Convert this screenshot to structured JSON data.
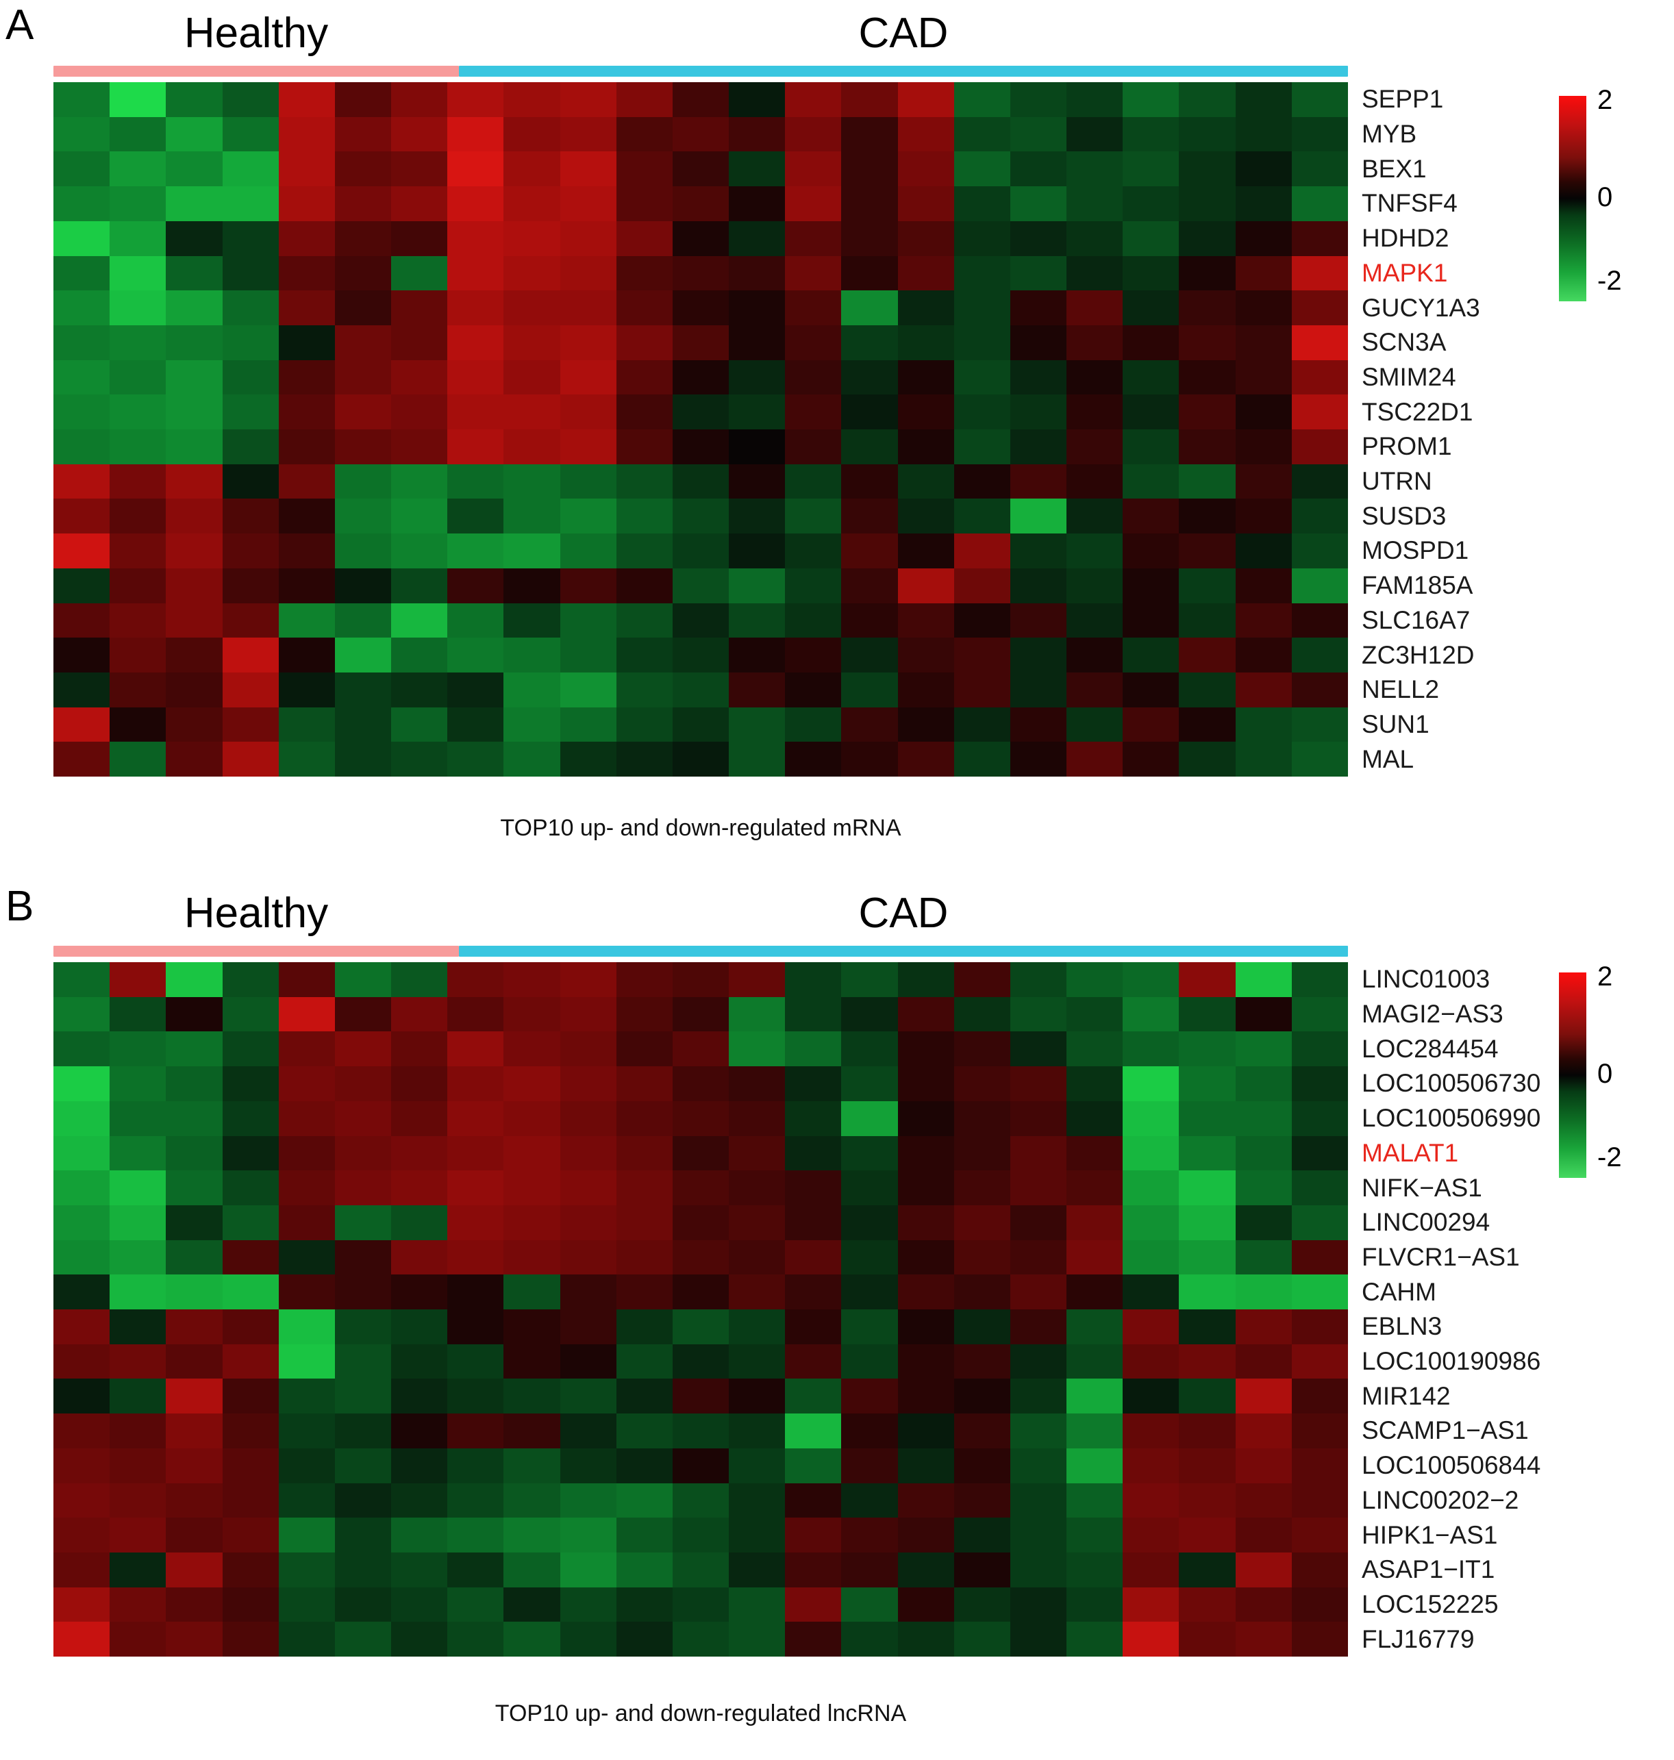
{
  "figure": {
    "colors": {
      "healthy_bar": "#f79b9b",
      "cad_bar": "#39c6e0",
      "highlight_label": "#e8261c",
      "heat_high": "#ff0000",
      "heat_mid": "#000000",
      "heat_low": "#00cc44"
    }
  },
  "panels": [
    {
      "letter": "A",
      "groups": {
        "healthy": "Healthy",
        "cad": "CAD"
      },
      "caption": "TOP10 up- and down-regulated mRNA",
      "legend": {
        "ticks": [
          "2",
          "0",
          "-2"
        ]
      },
      "chart_data": {
        "type": "heatmap",
        "title": "TOP10 up- and down-regulated mRNA",
        "xlabel": "",
        "ylabel": "",
        "zlim": [
          -2.5,
          2.5
        ],
        "colorbar_ticks": [
          2,
          0,
          -2
        ],
        "colormap": "green-black-red",
        "column_groups": [
          {
            "name": "Healthy",
            "columns": 4,
            "color": "#f79b9b"
          },
          {
            "name": "CAD",
            "columns": 19,
            "color": "#39c6e0"
          }
        ],
        "rows": [
          "SEPP1",
          "MYB",
          "BEX1",
          "TNFSF4",
          "HDHD2",
          "MAPK1",
          "GUCY1A3",
          "SCN3A",
          "SMIM24",
          "TSC22D1",
          "PROM1",
          "UTRN",
          "SUSD3",
          "MOSPD1",
          "FAM185A",
          "SLC16A7",
          "ZC3H12D",
          "NELL2",
          "SUN1",
          "MAL"
        ],
        "highlighted_rows": [
          "MAPK1"
        ],
        "values": [
          [
            -1.1,
            -2.4,
            -1.0,
            -0.7,
            1.6,
            0.6,
            1.0,
            1.5,
            1.3,
            1.4,
            1.0,
            0.4,
            -0.1,
            1.1,
            0.8,
            1.4,
            -0.8,
            -0.5,
            -0.4,
            -0.9,
            -0.6,
            -0.3,
            -0.7
          ],
          [
            -1.2,
            -1.0,
            -1.6,
            -1.0,
            1.5,
            0.9,
            1.2,
            1.9,
            1.1,
            1.2,
            0.5,
            0.6,
            0.4,
            0.9,
            0.3,
            1.0,
            -0.5,
            -0.6,
            -0.2,
            -0.5,
            -0.4,
            -0.3,
            -0.4
          ],
          [
            -1.0,
            -1.5,
            -1.3,
            -1.7,
            1.5,
            0.7,
            0.8,
            2.0,
            1.3,
            1.6,
            0.6,
            0.3,
            -0.3,
            1.1,
            0.3,
            0.9,
            -0.8,
            -0.4,
            -0.5,
            -0.6,
            -0.3,
            -0.1,
            -0.5
          ],
          [
            -1.2,
            -1.3,
            -1.8,
            -1.8,
            1.4,
            0.9,
            1.1,
            1.8,
            1.4,
            1.5,
            0.6,
            0.5,
            0.1,
            1.2,
            0.3,
            0.8,
            -0.4,
            -0.8,
            -0.5,
            -0.4,
            -0.3,
            -0.2,
            -0.9
          ],
          [
            -2.2,
            -1.6,
            -0.2,
            -0.4,
            0.9,
            0.5,
            0.4,
            1.6,
            1.5,
            1.4,
            0.9,
            0.1,
            -0.2,
            0.6,
            0.3,
            0.5,
            -0.3,
            -0.2,
            -0.3,
            -0.6,
            -0.2,
            0.1,
            0.4
          ],
          [
            -1.0,
            -2.1,
            -0.8,
            -0.4,
            0.6,
            0.4,
            -0.9,
            1.6,
            1.4,
            1.3,
            0.5,
            0.4,
            0.3,
            0.8,
            0.2,
            0.6,
            -0.4,
            -0.5,
            -0.2,
            -0.3,
            0.1,
            0.5,
            1.6
          ],
          [
            -1.3,
            -2.0,
            -1.6,
            -0.9,
            0.8,
            0.3,
            0.7,
            1.4,
            1.2,
            1.2,
            0.6,
            0.2,
            0.1,
            0.5,
            -1.3,
            -0.2,
            -0.4,
            0.2,
            0.6,
            -0.2,
            0.3,
            0.2,
            0.8
          ],
          [
            -1.1,
            -1.2,
            -1.1,
            -1.0,
            -0.1,
            0.8,
            0.7,
            1.6,
            1.3,
            1.4,
            0.9,
            0.5,
            0.1,
            0.4,
            -0.4,
            -0.3,
            -0.4,
            0.1,
            0.4,
            0.2,
            0.4,
            0.3,
            1.9
          ],
          [
            -1.3,
            -1.1,
            -1.4,
            -0.8,
            0.5,
            0.8,
            1.0,
            1.5,
            1.2,
            1.5,
            0.6,
            0.1,
            -0.2,
            0.3,
            -0.2,
            0.1,
            -0.5,
            -0.2,
            0.1,
            -0.3,
            0.2,
            0.3,
            1.0
          ],
          [
            -1.2,
            -1.3,
            -1.4,
            -0.9,
            0.6,
            1.0,
            0.9,
            1.4,
            1.4,
            1.3,
            0.4,
            -0.2,
            -0.3,
            0.4,
            -0.1,
            0.2,
            -0.4,
            -0.3,
            0.2,
            -0.2,
            0.4,
            0.1,
            1.5
          ],
          [
            -1.1,
            -1.2,
            -1.3,
            -0.6,
            0.5,
            0.7,
            0.8,
            1.5,
            1.3,
            1.4,
            0.5,
            0.1,
            0.0,
            0.3,
            -0.3,
            0.1,
            -0.5,
            -0.2,
            0.3,
            -0.4,
            0.3,
            0.2,
            0.9
          ],
          [
            1.5,
            0.9,
            1.3,
            -0.1,
            0.8,
            -1.0,
            -1.2,
            -0.9,
            -1.0,
            -0.8,
            -0.6,
            -0.3,
            0.1,
            -0.4,
            0.2,
            -0.3,
            0.1,
            0.4,
            0.2,
            -0.5,
            -0.7,
            0.3,
            -0.2
          ],
          [
            1.0,
            0.6,
            1.1,
            0.5,
            0.2,
            -1.1,
            -1.3,
            -0.5,
            -1.0,
            -1.2,
            -0.8,
            -0.5,
            -0.2,
            -0.6,
            0.3,
            -0.2,
            -0.4,
            -1.8,
            -0.2,
            0.3,
            0.1,
            0.2,
            -0.4
          ],
          [
            1.9,
            0.8,
            1.2,
            0.6,
            0.4,
            -1.0,
            -1.2,
            -1.4,
            -1.5,
            -1.0,
            -0.6,
            -0.4,
            -0.1,
            -0.3,
            0.5,
            0.1,
            1.1,
            -0.3,
            -0.4,
            0.2,
            0.3,
            -0.1,
            -0.5
          ],
          [
            -0.3,
            0.6,
            1.0,
            0.4,
            0.2,
            -0.1,
            -0.5,
            0.3,
            0.1,
            0.4,
            0.2,
            -0.6,
            -0.9,
            -0.4,
            0.3,
            1.4,
            0.8,
            -0.2,
            -0.3,
            0.1,
            -0.4,
            0.2,
            -1.2
          ],
          [
            0.6,
            0.8,
            1.0,
            0.7,
            -1.2,
            -0.9,
            -1.9,
            -1.0,
            -0.4,
            -0.8,
            -0.6,
            -0.2,
            -0.5,
            -0.3,
            0.2,
            0.4,
            0.1,
            0.3,
            -0.2,
            0.1,
            -0.3,
            0.4,
            0.2
          ],
          [
            0.1,
            0.7,
            0.5,
            1.7,
            0.1,
            -1.7,
            -0.9,
            -1.1,
            -1.0,
            -0.8,
            -0.4,
            -0.3,
            0.1,
            0.2,
            -0.2,
            0.3,
            0.4,
            -0.2,
            0.1,
            -0.3,
            0.5,
            0.2,
            -0.4
          ],
          [
            -0.2,
            0.5,
            0.4,
            1.4,
            -0.1,
            -0.4,
            -0.3,
            -0.2,
            -1.2,
            -1.4,
            -0.6,
            -0.5,
            0.3,
            0.1,
            -0.4,
            0.2,
            0.4,
            -0.2,
            0.3,
            0.1,
            -0.3,
            0.6,
            0.3
          ],
          [
            1.6,
            0.1,
            0.5,
            0.8,
            -0.6,
            -0.4,
            -0.8,
            -0.3,
            -1.1,
            -0.9,
            -0.5,
            -0.3,
            -0.6,
            -0.4,
            0.3,
            0.1,
            -0.2,
            0.2,
            -0.3,
            0.4,
            0.1,
            -0.5,
            -0.6
          ],
          [
            0.7,
            -0.8,
            0.6,
            1.4,
            -0.7,
            -0.4,
            -0.5,
            -0.6,
            -0.9,
            -0.3,
            -0.2,
            -0.1,
            -0.6,
            0.1,
            0.2,
            0.4,
            -0.4,
            0.1,
            0.6,
            0.2,
            -0.3,
            -0.5,
            -0.7
          ]
        ]
      }
    },
    {
      "letter": "B",
      "groups": {
        "healthy": "Healthy",
        "cad": "CAD"
      },
      "caption": "TOP10 up- and down-regulated lncRNA",
      "legend": {
        "ticks": [
          "2",
          "0",
          "-2"
        ]
      },
      "chart_data": {
        "type": "heatmap",
        "title": "TOP10 up- and down-regulated lncRNA",
        "xlabel": "",
        "ylabel": "",
        "zlim": [
          -2.5,
          2.5
        ],
        "colorbar_ticks": [
          2,
          0,
          -2
        ],
        "colormap": "green-black-red",
        "column_groups": [
          {
            "name": "Healthy",
            "columns": 4,
            "color": "#f79b9b"
          },
          {
            "name": "CAD",
            "columns": 19,
            "color": "#39c6e0"
          }
        ],
        "rows": [
          "LINC01003",
          "MAGI2-AS3",
          "LOC284454",
          "LOC100506730",
          "LOC100506990",
          "MALAT1",
          "NIFK-AS1",
          "LINC00294",
          "FLVCR1-AS1",
          "CAHM",
          "EBLN3",
          "LOC100190986",
          "MIR142",
          "SCAMP1-AS1",
          "LOC100506844",
          "LINC00202-2",
          "HIPK1-AS1",
          "ASAP1-IT1",
          "LOC152225",
          "FLJ16779"
        ],
        "highlighted_rows": [
          "MALAT1"
        ],
        "values": [
          [
            -0.9,
            1.1,
            -2.1,
            -0.6,
            0.6,
            -1.0,
            -0.7,
            0.8,
            0.9,
            1.0,
            0.6,
            0.5,
            0.7,
            -0.4,
            -0.6,
            -0.3,
            0.4,
            -0.5,
            -0.8
          ],
          [
            -1.1,
            -0.5,
            0.1,
            -0.7,
            1.8,
            0.4,
            0.9,
            0.6,
            0.8,
            0.9,
            0.5,
            0.3,
            -1.1,
            -0.4,
            -0.2,
            0.4,
            -0.3,
            -0.6,
            -0.5
          ],
          [
            -0.8,
            -0.9,
            -1.0,
            -0.5,
            0.8,
            1.0,
            0.7,
            1.2,
            0.9,
            0.8,
            0.4,
            0.6,
            -1.2,
            -0.9,
            -0.4,
            0.2,
            0.3,
            -0.2,
            -0.6
          ],
          [
            -2.2,
            -1.0,
            -0.8,
            -0.3,
            0.9,
            0.8,
            0.6,
            1.0,
            1.1,
            0.9,
            0.7,
            0.4,
            0.3,
            -0.2,
            -0.5,
            0.2,
            0.4,
            0.5,
            -0.3
          ],
          [
            -2.0,
            -0.9,
            -0.9,
            -0.4,
            0.8,
            0.9,
            0.7,
            1.1,
            1.0,
            0.8,
            0.6,
            0.5,
            0.4,
            -0.3,
            -1.6,
            0.1,
            0.3,
            0.4,
            -0.2
          ],
          [
            -1.9,
            -1.1,
            -0.8,
            -0.2,
            0.6,
            0.8,
            0.9,
            1.0,
            1.1,
            0.9,
            0.7,
            0.3,
            0.5,
            -0.2,
            -0.4,
            0.2,
            0.3,
            0.6,
            0.4
          ],
          [
            -1.6,
            -2.0,
            -0.9,
            -0.5,
            0.7,
            0.9,
            1.0,
            1.2,
            1.1,
            1.0,
            0.8,
            0.5,
            0.4,
            0.3,
            -0.3,
            0.2,
            0.4,
            0.6,
            0.5
          ],
          [
            -1.4,
            -1.8,
            -0.3,
            -0.7,
            0.6,
            -0.8,
            -0.6,
            1.1,
            1.0,
            0.9,
            0.8,
            0.4,
            0.5,
            0.3,
            -0.2,
            0.4,
            0.6,
            0.3,
            0.8
          ],
          [
            -1.3,
            -1.5,
            -0.7,
            0.5,
            -0.2,
            0.3,
            0.9,
            1.0,
            0.9,
            0.8,
            0.7,
            0.5,
            0.4,
            0.6,
            -0.3,
            0.2,
            0.5,
            0.4,
            0.9
          ],
          [
            -0.2,
            -1.9,
            -1.8,
            -1.9,
            0.4,
            0.3,
            0.2,
            0.1,
            -0.6,
            0.3,
            0.4,
            0.2,
            0.5,
            0.3,
            -0.2,
            0.4,
            0.3,
            0.6,
            0.2
          ],
          [
            0.9,
            -0.2,
            0.8,
            0.6,
            -2.0,
            -0.5,
            -0.4,
            0.1,
            0.2,
            0.3,
            -0.3,
            -0.6,
            -0.4,
            0.2,
            -0.5,
            0.1,
            -0.2,
            0.3,
            -0.6
          ],
          [
            0.7,
            0.8,
            0.6,
            0.9,
            -2.1,
            -0.6,
            -0.3,
            -0.4,
            0.2,
            0.1,
            -0.5,
            -0.2,
            -0.3,
            0.4,
            -0.4,
            0.2,
            0.3,
            -0.2,
            -0.5
          ],
          [
            -0.1,
            -0.4,
            1.5,
            0.4,
            -0.5,
            -0.6,
            -0.2,
            -0.3,
            -0.4,
            -0.5,
            -0.2,
            0.3,
            0.1,
            -0.6,
            0.4,
            0.2,
            0.1,
            -0.3,
            -1.7
          ],
          [
            0.7,
            0.6,
            1.0,
            0.5,
            -0.4,
            -0.3,
            0.1,
            0.4,
            0.3,
            -0.2,
            -0.5,
            -0.4,
            -0.3,
            -1.9,
            0.2,
            -0.1,
            0.3,
            -0.6,
            -1.1
          ],
          [
            0.8,
            0.7,
            0.9,
            0.6,
            -0.3,
            -0.5,
            -0.2,
            -0.4,
            -0.6,
            -0.3,
            -0.2,
            0.1,
            -0.4,
            -0.8,
            0.3,
            -0.2,
            0.2,
            -0.5,
            -1.6
          ],
          [
            0.9,
            0.8,
            0.7,
            0.6,
            -0.4,
            -0.2,
            -0.3,
            -0.5,
            -0.7,
            -0.9,
            -1.0,
            -0.6,
            -0.3,
            0.2,
            -0.2,
            0.4,
            0.3,
            -0.4,
            -0.8
          ],
          [
            0.8,
            0.9,
            0.6,
            0.7,
            -1.0,
            -0.4,
            -0.8,
            -0.9,
            -1.1,
            -1.2,
            -0.7,
            -0.5,
            -0.3,
            0.6,
            0.4,
            0.3,
            -0.2,
            -0.4,
            -0.6
          ],
          [
            0.7,
            -0.2,
            1.2,
            0.5,
            -0.6,
            -0.4,
            -0.5,
            -0.3,
            -0.8,
            -1.3,
            -0.9,
            -0.6,
            -0.2,
            0.4,
            0.3,
            -0.2,
            0.1,
            -0.4,
            -0.5
          ],
          [
            1.3,
            0.8,
            0.6,
            0.4,
            -0.5,
            -0.3,
            -0.4,
            -0.6,
            -0.2,
            -0.5,
            -0.3,
            -0.4,
            -0.6,
            0.9,
            -0.7,
            0.2,
            -0.3,
            -0.2,
            -0.4
          ],
          [
            1.8,
            0.7,
            0.8,
            0.5,
            -0.4,
            -0.6,
            -0.3,
            -0.5,
            -0.7,
            -0.4,
            -0.2,
            -0.5,
            -0.6,
            0.3,
            -0.4,
            -0.3,
            -0.5,
            -0.2,
            -0.6
          ]
        ]
      }
    }
  ]
}
